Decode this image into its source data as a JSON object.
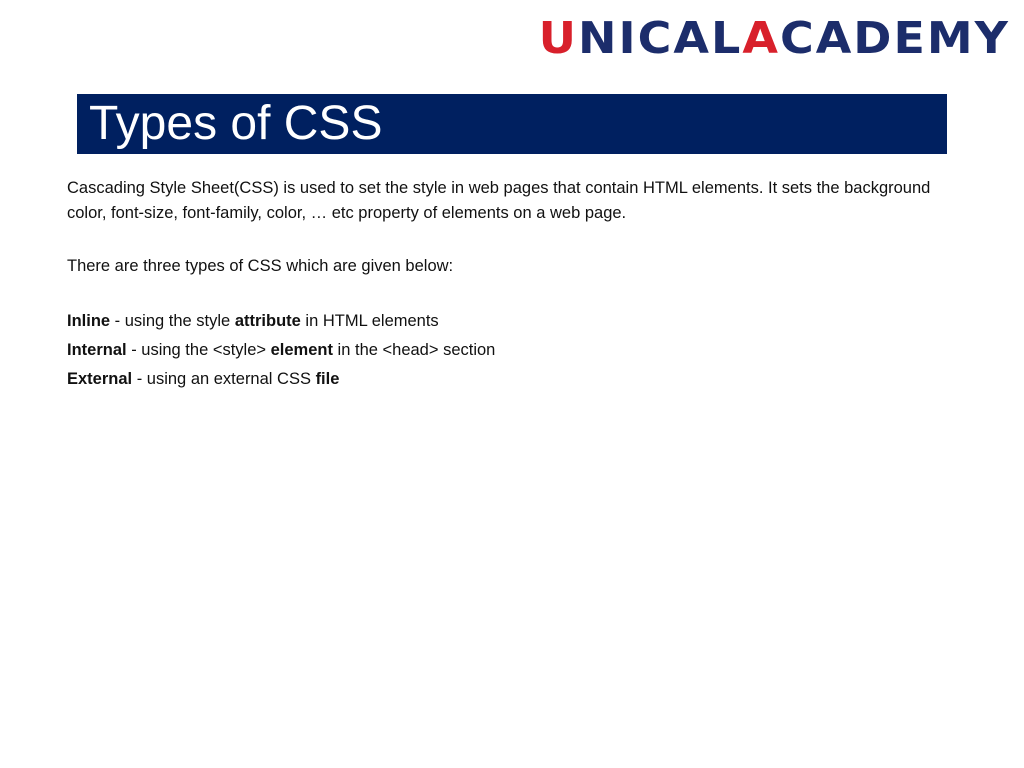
{
  "logo": {
    "first_letter": "U",
    "word1_rest": "NICAL",
    "second_first_letter": "A",
    "word2_rest": "CADEMY",
    "colors": {
      "red": "#d8202b",
      "navy": "#1c2d6b"
    }
  },
  "slide": {
    "title": "Types of CSS",
    "title_bar_color": "#002060",
    "intro": "Cascading Style Sheet(CSS) is used to set the style in web pages that contain HTML elements. It sets the background color, font-size, font-family, color, … etc property of elements on a web page.",
    "lead": "There are three types of CSS which are given below:",
    "types": [
      {
        "name": "Inline",
        "t1": " - using the style ",
        "b2": "attribute",
        "t2": " in HTML elements"
      },
      {
        "name": "Internal",
        "t1": " - using the <style> ",
        "b2": "element",
        "t2": " in the <head> section"
      },
      {
        "name": "External",
        "t1": " - using an external CSS ",
        "b2": "file",
        "t2": ""
      }
    ]
  }
}
